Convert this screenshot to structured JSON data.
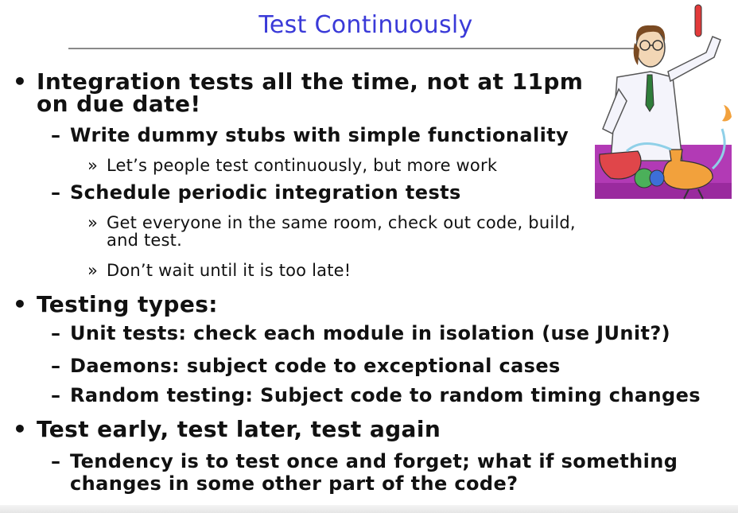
{
  "slide": {
    "title": "Test Continuously",
    "items": [
      {
        "level": 1,
        "marker": "•",
        "lines": [
          "Integration tests all the time, not at 11pm",
          "on due date!"
        ]
      },
      {
        "level": 2,
        "marker": "–",
        "lines": [
          "Write dummy stubs with simple functionality"
        ]
      },
      {
        "level": 3,
        "marker": "»",
        "lines": [
          "Let’s people test continuously, but more work"
        ]
      },
      {
        "level": 2,
        "marker": "–",
        "lines": [
          "Schedule periodic integration tests"
        ]
      },
      {
        "level": 3,
        "marker": "»",
        "lines": [
          "Get everyone in the same room, check out code, build,",
          "and test."
        ]
      },
      {
        "level": 3,
        "marker": "»",
        "lines": [
          "Don’t wait until it is too late!"
        ]
      },
      {
        "level": 1,
        "marker": "•",
        "lines": [
          "Testing types:"
        ]
      },
      {
        "level": 2,
        "marker": "–",
        "lines": [
          "Unit tests: check each module in isolation (use JUnit?)"
        ]
      },
      {
        "level": 2,
        "marker": "–",
        "lines": [
          "Daemons: subject code to exceptional cases"
        ]
      },
      {
        "level": 2,
        "marker": "–",
        "lines": [
          "Random testing: Subject code to random timing changes"
        ]
      },
      {
        "level": 1,
        "marker": "•",
        "lines": [
          "Test early, test later, test again"
        ]
      },
      {
        "level": 2,
        "marker": "–",
        "lines": [
          "Tendency is to test once and forget; what if something",
          "changes in some other part of the code?"
        ]
      }
    ]
  },
  "illustration": {
    "icon": "scientist-lab-icon"
  },
  "colors": {
    "title": "#3a3ad8",
    "rule": "#8a8a8a",
    "text": "#111111",
    "illustration_bg": "#b23ab5"
  }
}
